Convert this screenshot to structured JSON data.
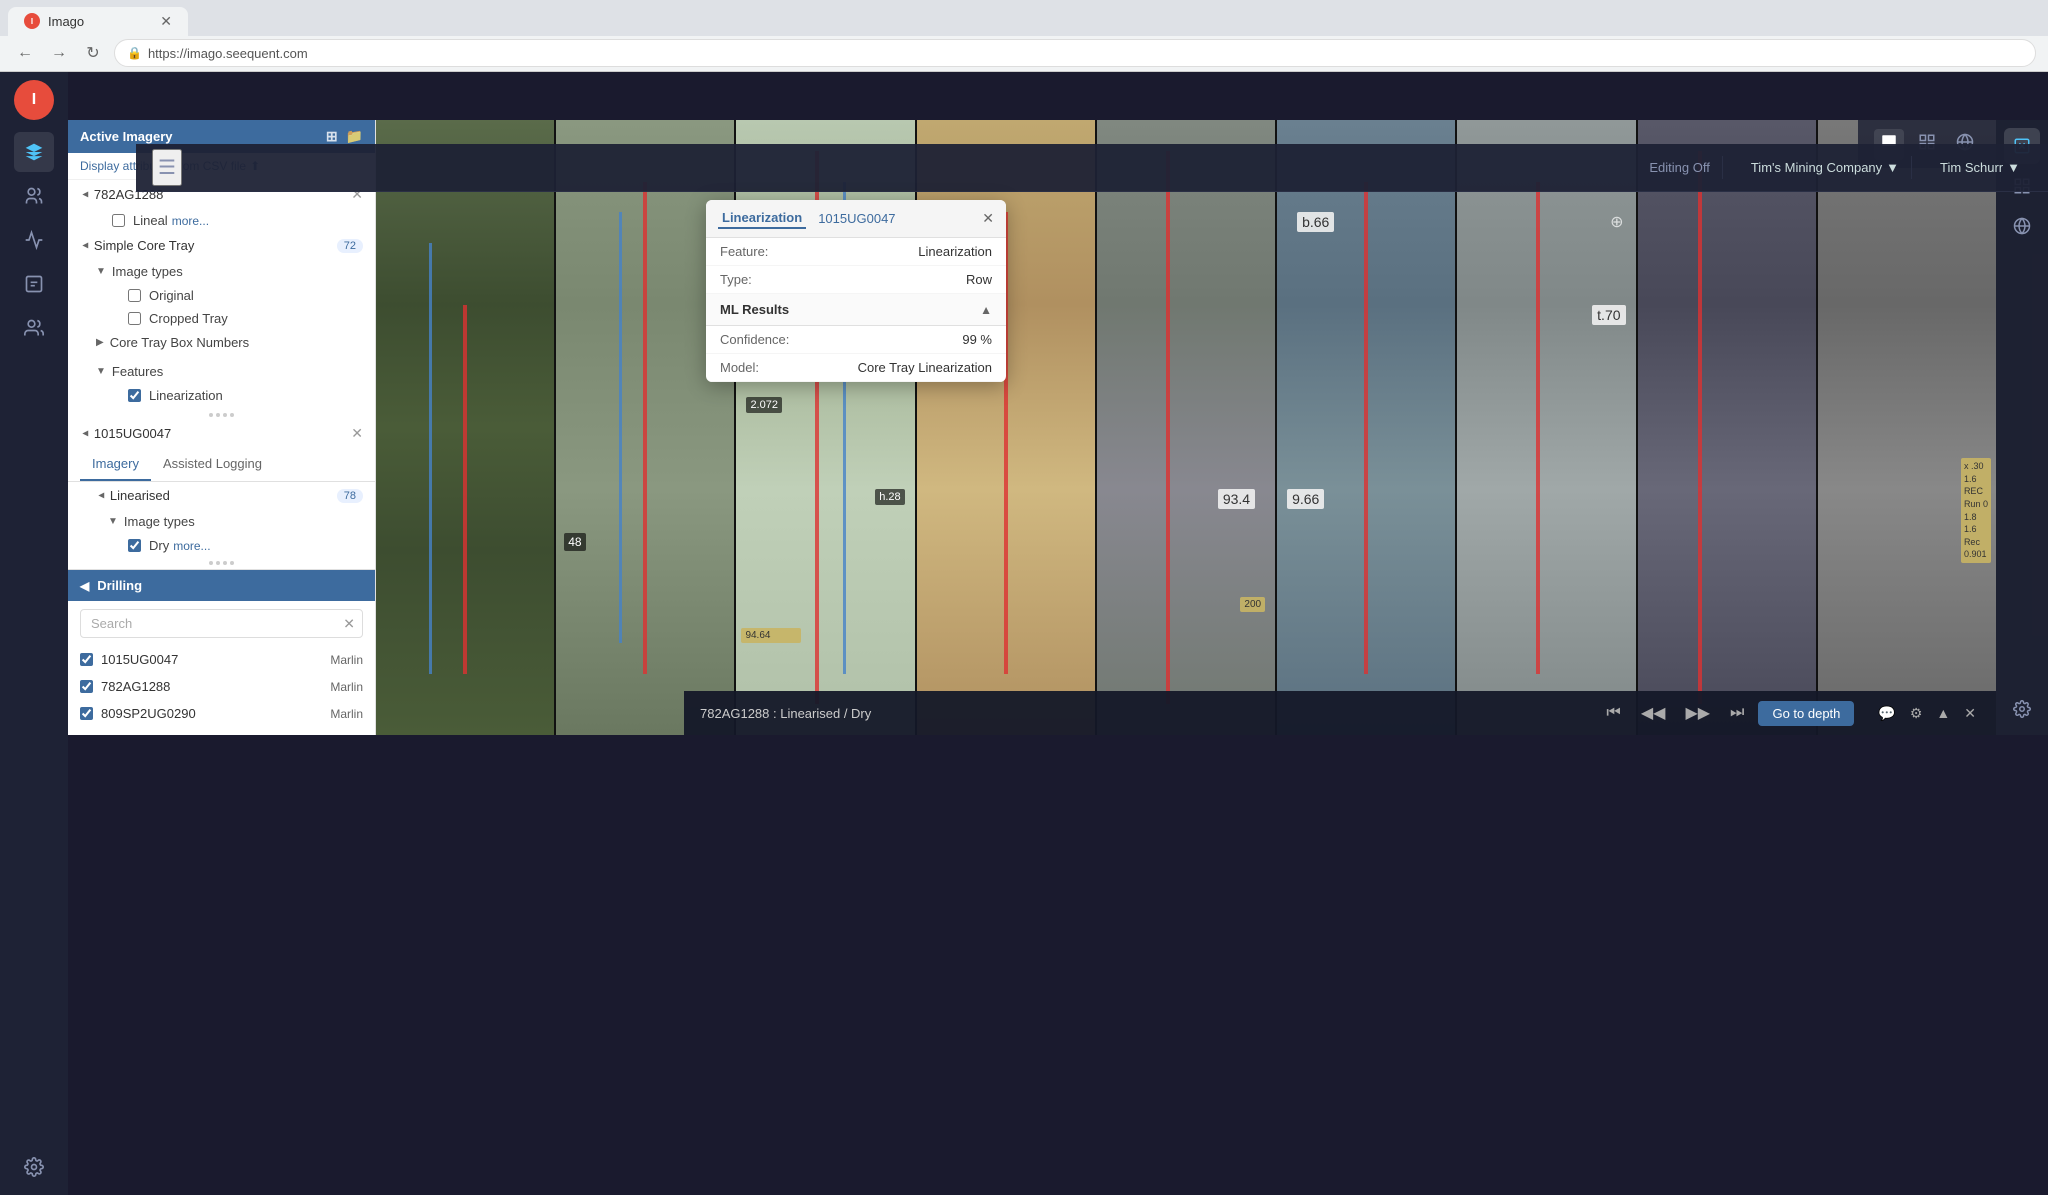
{
  "browser": {
    "tab_title": "Imago",
    "tab_favicon": "I",
    "address": "https://imago.seequent.com"
  },
  "header": {
    "menu_icon": "☰",
    "editing_off": "Editing Off",
    "company": "Tim's Mining Company",
    "user": "Tim Schurr",
    "chevron": "▼"
  },
  "sidebar_icons": [
    "●",
    "⊞",
    "👥",
    "📊",
    "🔧",
    "👤",
    "⚙"
  ],
  "left_panel": {
    "active_imagery_title": "Active Imagery",
    "csv_link": "Display attributes from CSV file",
    "items": [
      {
        "id": "782AG1288",
        "label": "782AG1288"
      }
    ],
    "simple_core_tray": {
      "label": "Simple Core Tray",
      "badge": "72",
      "image_types_label": "Image types",
      "original_label": "Original",
      "cropped_tray_label": "Cropped Tray",
      "core_tray_box_label": "Core Tray Box Numbers",
      "features_label": "Features",
      "linearization_label": "Linearization"
    },
    "second_item": {
      "id": "1015UG0047",
      "label": "1015UG0047"
    },
    "tabs": {
      "imagery": "Imagery",
      "assisted_logging": "Assisted Logging"
    },
    "linearised": {
      "label": "Linearised",
      "badge": "78",
      "image_types_label": "Image types",
      "dry_label": "Dry",
      "more_label": "more..."
    }
  },
  "drilling": {
    "title": "Drilling",
    "search_placeholder": "Search",
    "items": [
      {
        "id": "1015UG0047",
        "company": "Marlin"
      },
      {
        "id": "782AG1288",
        "company": "Marlin"
      },
      {
        "id": "809SP2UG0290",
        "company": "Marlin"
      }
    ]
  },
  "tooltip": {
    "tab1": "Linearization",
    "tab2": "1015UG0047",
    "feature_label": "Feature:",
    "feature_value": "Linearization",
    "type_label": "Type:",
    "type_value": "Row",
    "ml_results_title": "ML Results",
    "confidence_label": "Confidence:",
    "confidence_value": "99 %",
    "model_label": "Model:",
    "model_value": "Core Tray Linearization"
  },
  "bottom_bar": {
    "info": "782AG1288 : Linearised / Dry",
    "go_to_depth": "Go to depth"
  },
  "viewer_controls": {
    "grid_icon": "⊞",
    "list_icon": "≡",
    "globe_icon": "🌐"
  },
  "right_tools": {
    "icons": [
      "🖼",
      "⊞",
      "🌐"
    ],
    "gear": "⚙"
  },
  "core_images": [
    {
      "col": 1,
      "class": "core-col-1"
    },
    {
      "col": 2,
      "class": "core-col-2"
    },
    {
      "col": 3,
      "class": "core-col-3"
    },
    {
      "col": 4,
      "class": "core-col-4"
    },
    {
      "col": 5,
      "class": "core-col-5"
    },
    {
      "col": 6,
      "class": "core-col-6"
    },
    {
      "col": 7,
      "class": "core-col-7"
    },
    {
      "col": 8,
      "class": "core-col-8"
    },
    {
      "col": 9,
      "class": "core-col-9"
    }
  ]
}
